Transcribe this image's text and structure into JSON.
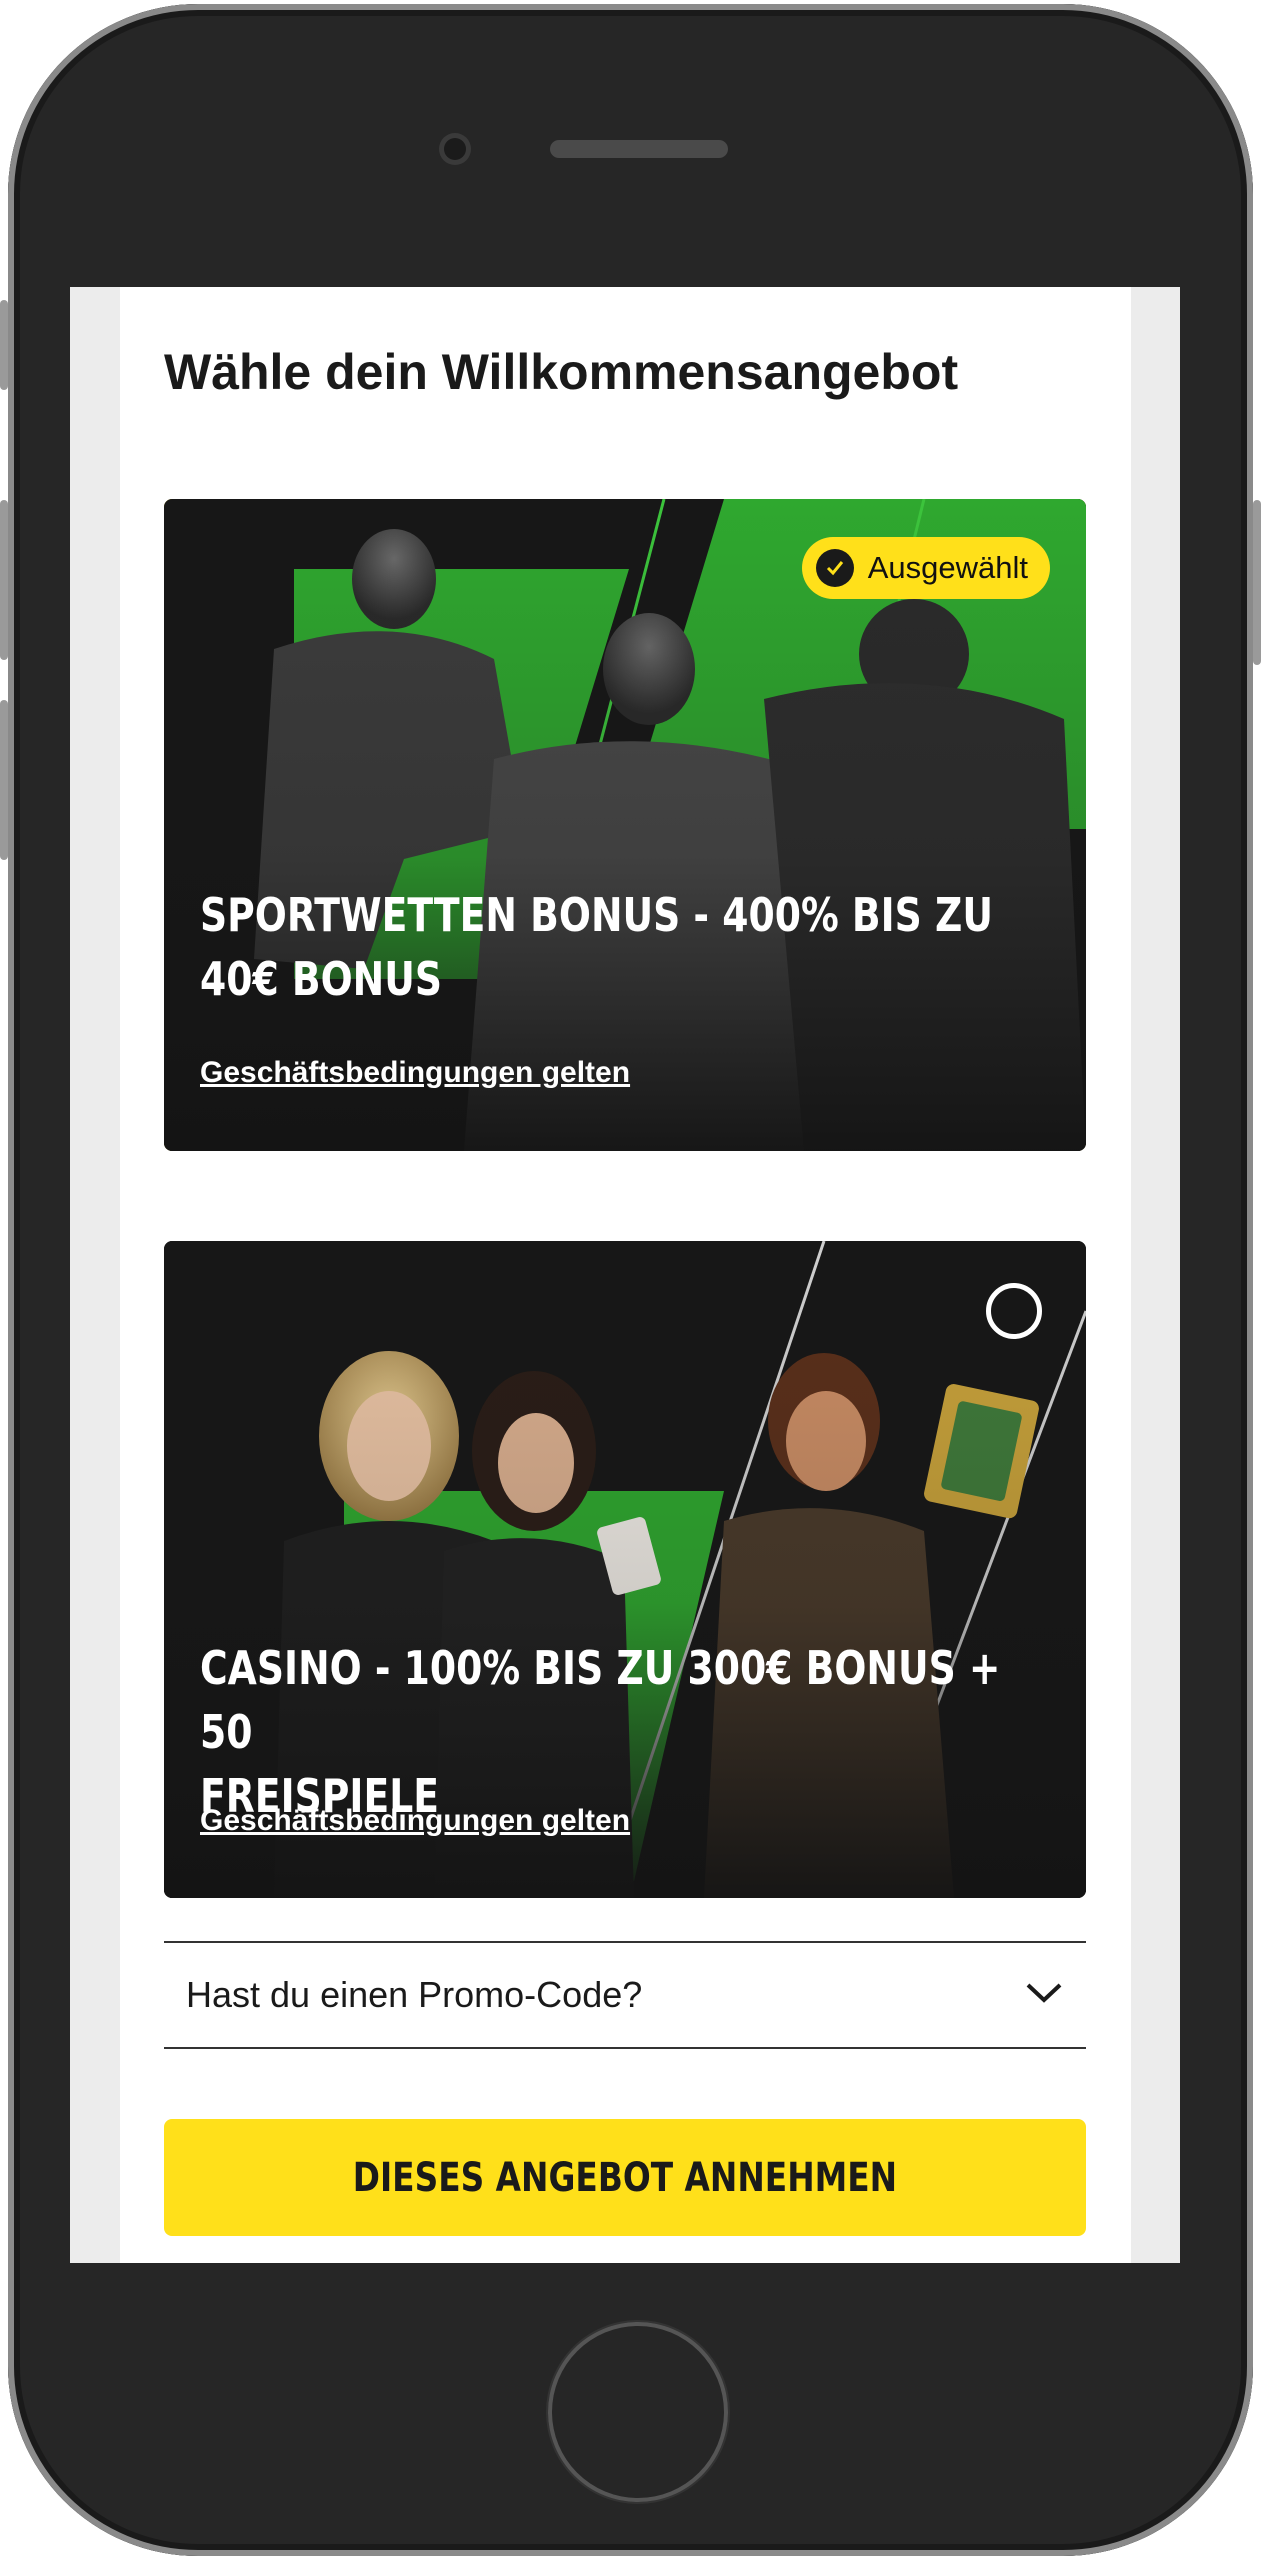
{
  "page": {
    "title": "Wähle dein Willkommensangebot"
  },
  "offers": [
    {
      "headline_line1": "SPORTWETTEN BONUS - 400% BIS ZU",
      "headline_line2": "40€ BONUS",
      "terms": "Geschäftsbedingungen gelten",
      "selected": true,
      "badge_label": "Ausgewählt",
      "badge_icon": "checkmark-icon"
    },
    {
      "headline_line1": "CASINO - 100% BIS ZU 300€ BONUS + 50",
      "headline_line2": "FREISPIELE",
      "terms": "Geschäftsbedingungen gelten",
      "selected": false
    }
  ],
  "promo": {
    "label": "Hast du einen Promo-Code?",
    "icon": "chevron-down-icon"
  },
  "cta": {
    "label": "DIESES ANGEBOT ANNEHMEN"
  },
  "colors": {
    "accent": "#ffe01a",
    "brand_green": "#2fa82f",
    "card_dark": "#161616",
    "text": "#1a1a1a"
  }
}
